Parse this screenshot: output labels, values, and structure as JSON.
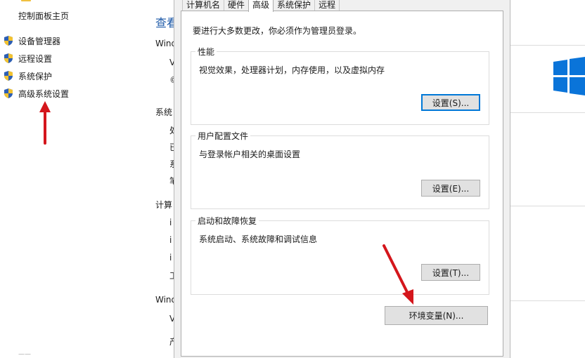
{
  "sidebar": {
    "home_label": "控制面板主页",
    "items": [
      {
        "label": "设备管理器"
      },
      {
        "label": "远程设置"
      },
      {
        "label": "系统保护"
      },
      {
        "label": "高级系统设置"
      }
    ]
  },
  "middle": {
    "title_partial": "查看",
    "sections": [
      "Wind",
      "系统",
      "计算",
      "Wind"
    ],
    "sub_chars": [
      "V",
      "©",
      "处",
      "已",
      "系",
      "笔",
      "i",
      "i",
      "i",
      "工",
      "V",
      "产"
    ]
  },
  "dialog": {
    "tabs": [
      {
        "label": "计算机名",
        "active": false
      },
      {
        "label": "硬件",
        "active": false
      },
      {
        "label": "高级",
        "active": true
      },
      {
        "label": "系统保护",
        "active": false
      },
      {
        "label": "远程",
        "active": false
      }
    ],
    "admin_note": "要进行大多数更改，你必须作为管理员登录。",
    "groups": [
      {
        "title": "性能",
        "desc": "视觉效果，处理器计划，内存使用，以及虚拟内存",
        "button": "设置(S)..."
      },
      {
        "title": "用户配置文件",
        "desc": "与登录帐户相关的桌面设置",
        "button": "设置(E)..."
      },
      {
        "title": "启动和故障恢复",
        "desc": "系统启动、系统故障和调试信息",
        "button": "设置(T)..."
      }
    ],
    "env_button": "环境变量(N)..."
  },
  "colors": {
    "accent": "#0078d7",
    "link_title": "#1e5aa8",
    "annotation_arrow": "#d4161c",
    "windows_logo": "#0a74d9"
  }
}
